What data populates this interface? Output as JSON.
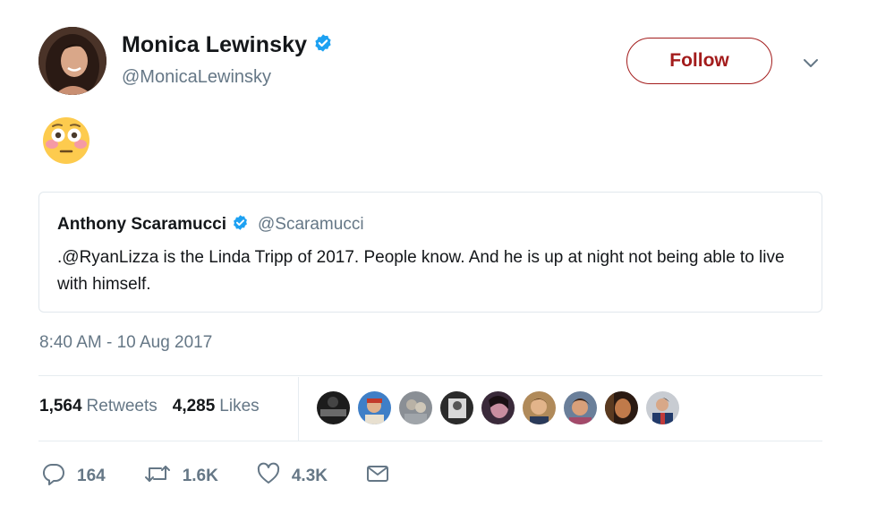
{
  "author": {
    "name": "Monica Lewinsky",
    "handle": "@MonicaLewinsky",
    "verified": true
  },
  "follow_label": "Follow",
  "tweet_body": "😳",
  "quoted": {
    "name": "Anthony Scaramucci",
    "handle": "@Scaramucci",
    "verified": true,
    "text": ".@RyanLizza is the Linda Tripp of 2017. People know. And he is up at night not being able to live with himself."
  },
  "timestamp": "8:40 AM - 10 Aug 2017",
  "stats": {
    "retweets_count": "1,564",
    "retweets_label": "Retweets",
    "likes_count": "4,285",
    "likes_label": "Likes"
  },
  "actions": {
    "reply_count": "164",
    "retweet_count": "1.6K",
    "like_count": "4.3K"
  },
  "icons": [
    "verified-badge-icon",
    "chevron-down-icon",
    "reply-icon",
    "retweet-icon",
    "heart-icon",
    "envelope-icon"
  ],
  "colors": {
    "follow_accent": "#a31c1c",
    "verified": "#1da1f2",
    "muted_text": "#657786",
    "border": "#e1e8ed"
  },
  "liker_avatars": 9
}
